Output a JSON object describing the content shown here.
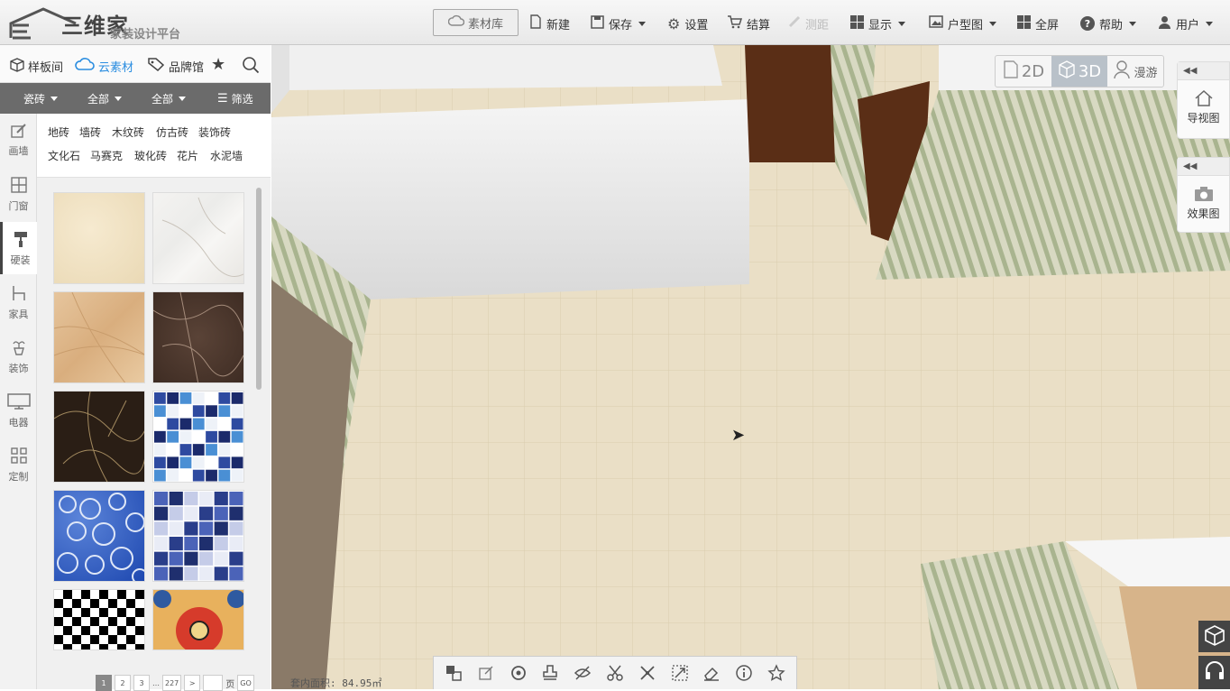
{
  "app": {
    "logo_text": "三维家",
    "subtitle": "家装设计平台"
  },
  "toolbar": {
    "library": "素材库",
    "new": "新建",
    "save": "保存",
    "settings": "设置",
    "checkout": "结算",
    "measure": "测距",
    "display": "显示",
    "floorplan": "户型图",
    "fullscreen": "全屏",
    "help": "帮助",
    "user": "用户"
  },
  "panel_tabs": {
    "showroom": "样板间",
    "cloud": "云素材",
    "brand": "品牌馆"
  },
  "filters": {
    "category": "瓷砖",
    "f1": "全部",
    "f2": "全部",
    "filter": "筛选"
  },
  "left_nav": [
    "画墙",
    "门窗",
    "硬装",
    "家具",
    "装饰",
    "电器",
    "定制"
  ],
  "categories": [
    "地砖",
    "墙砖",
    "木纹砖",
    "仿古砖",
    "装饰砖",
    "文化石",
    "马赛克",
    "玻化砖",
    "花片",
    "水泥墙"
  ],
  "pager": {
    "p1": "1",
    "p2": "2",
    "p3": "3",
    "ellipsis": "…",
    "last": "227",
    "next": ">",
    "page_label": "页",
    "go": "GO"
  },
  "view": {
    "v2d": "2D",
    "v3d": "3D",
    "walk": "漫游"
  },
  "right_panels": {
    "nav_map": "导视图",
    "render": "效果图"
  },
  "area": "套内面积: 84.95㎡",
  "colors": {
    "accent": "#2a8de0",
    "filter_bar": "#6b6b6b",
    "floor": "#e8dcc2"
  }
}
